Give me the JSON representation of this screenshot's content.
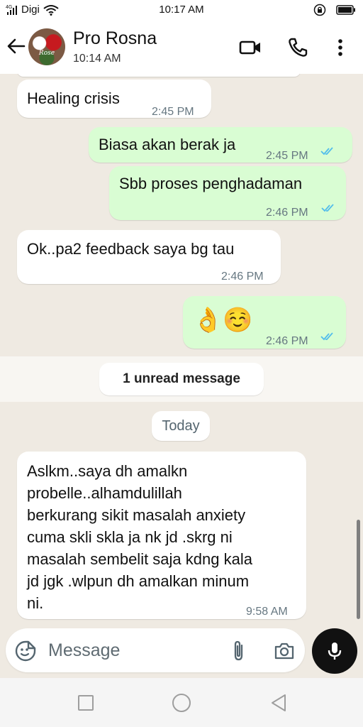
{
  "status_bar": {
    "network_type": "4G",
    "carrier": "Digi",
    "time": "10:17 AM",
    "icons": [
      "signal-icon",
      "wifi-icon",
      "lock-rotation-icon",
      "battery-icon"
    ]
  },
  "header": {
    "contact_name": "Pro Rosna",
    "subtitle": "10:14 AM",
    "avatar_text": "Rose",
    "icons": [
      "back-arrow-icon",
      "video-call-icon",
      "phone-icon",
      "more-vert-icon"
    ]
  },
  "messages": [
    {
      "direction": "in",
      "text": "Healing crisis",
      "time": "2:45 PM"
    },
    {
      "direction": "out",
      "text": "Biasa akan berak ja",
      "time": "2:45 PM",
      "status": "read"
    },
    {
      "direction": "out",
      "text": "Sbb proses penghadaman",
      "time": "2:46 PM",
      "status": "read"
    },
    {
      "direction": "in",
      "text": "Ok..pa2 feedback saya bg tau",
      "time": "2:46 PM"
    },
    {
      "direction": "out",
      "text": "👌☺️",
      "time": "2:46 PM",
      "status": "read"
    }
  ],
  "unread_banner": "1 unread message",
  "date_divider": "Today",
  "last_message": {
    "direction": "in",
    "lines": [
      "Aslkm..saya dh amalkn",
      "probelle..alhamdulillah",
      "berkurang sikit masalah anxiety",
      "cuma skli skla ja nk jd .skrg ni",
      "masalah sembelit saja kdng kala",
      "jd jgk .wlpun dh amalkan minum",
      "ni."
    ],
    "time": "9:58 AM"
  },
  "composer": {
    "placeholder": "Message",
    "icons": [
      "emoji-icon",
      "attach-icon",
      "camera-icon",
      "mic-icon"
    ]
  },
  "colors": {
    "chat_background": "#efeae2",
    "outgoing_bubble": "#d9fdd3",
    "incoming_bubble": "#ffffff",
    "read_ticks": "#53bdeb",
    "mic_button": "#111111"
  }
}
